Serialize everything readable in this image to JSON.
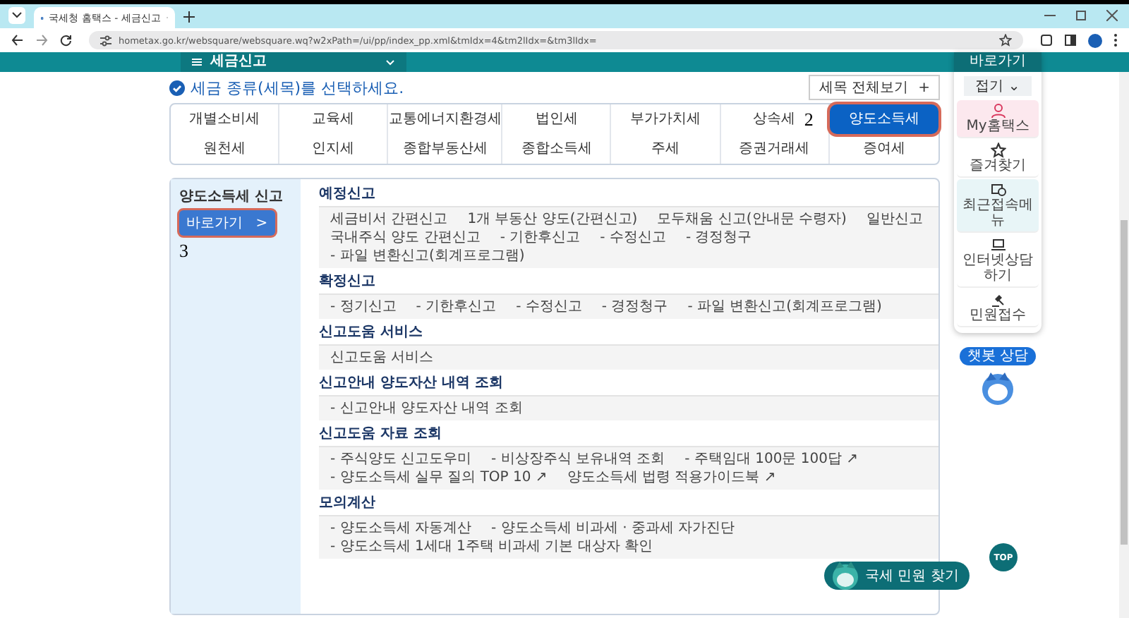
{
  "browser": {
    "tab_title": "국세청 홈택스 - 세금신고",
    "url": "hometax.go.kr/websquare/websquare.wq?w2xPath=/ui/pp/index_pp.xml&tmIdx=4&tm2lIdx=&tm3lIdx="
  },
  "nav": {
    "menu": "세금신고"
  },
  "heading": "세금 종류(세목)를 선택하세요.",
  "view_all": {
    "label": "세목 전체보기",
    "icon": "+"
  },
  "tax_types": [
    {
      "label": "개별소비세",
      "selected": false
    },
    {
      "label": "교육세",
      "selected": false
    },
    {
      "label": "교통에너지환경세",
      "selected": false
    },
    {
      "label": "법인세",
      "selected": false
    },
    {
      "label": "부가가치세",
      "selected": false
    },
    {
      "label": "상속세",
      "selected": false
    },
    {
      "label": "양도소득세",
      "selected": true
    },
    {
      "label": "원천세",
      "selected": false
    },
    {
      "label": "인지세",
      "selected": false
    },
    {
      "label": "종합부동산세",
      "selected": false
    },
    {
      "label": "종합소득세",
      "selected": false
    },
    {
      "label": "주세",
      "selected": false
    },
    {
      "label": "증권거래세",
      "selected": false
    },
    {
      "label": "증여세",
      "selected": false
    }
  ],
  "annotations": [
    "2",
    "3"
  ],
  "side": {
    "title": "양도소득세 신고",
    "button": "바로가기",
    "arrow": ">"
  },
  "sections": [
    {
      "title": "예정신고",
      "items": [
        "세금비서 간편신고",
        "1개 부동산 양도(간편신고)",
        "모두채움 신고(안내문 수령자)",
        "일반신고",
        "국내주식 양도 간편신고",
        "- 기한후신고",
        "- 수정신고",
        "- 경정청구",
        "- 파일 변환신고(회계프로그램)"
      ]
    },
    {
      "title": "확정신고",
      "items": [
        "- 정기신고",
        "- 기한후신고",
        "- 수정신고",
        "- 경정청구",
        "- 파일 변환신고(회계프로그램)"
      ]
    },
    {
      "title": "신고도움 서비스",
      "items": [
        "신고도움 서비스"
      ]
    },
    {
      "title": "신고안내 양도자산 내역 조회",
      "items": [
        "- 신고안내 양도자산 내역 조회"
      ]
    },
    {
      "title": "신고도움 자료 조회",
      "items": [
        "- 주식양도 신고도우미",
        "- 비상장주식 보유내역 조회",
        "- 주택임대 100문 100답 ↗",
        "- 양도소득세 실무 질의 TOP 10 ↗",
        "양도소득세 법령 적용가이드북 ↗"
      ]
    },
    {
      "title": "모의계산",
      "items": [
        "- 양도소득세 자동계산",
        "- 양도소득세 비과세 · 중과세 자가진단",
        "- 양도소득세 1세대 1주택 비과세 기본 대상자 확인"
      ]
    }
  ],
  "quick": {
    "title": "바로가기",
    "collapse": "접기 ⌄",
    "items": [
      {
        "label": "My홈택스",
        "kind": "person",
        "color": "#fce8ee"
      },
      {
        "label": "즐겨찾기",
        "kind": "star",
        "color": "#ffffff"
      },
      {
        "label": "최근접속메뉴",
        "kind": "recent",
        "color": "#e8f5f7"
      },
      {
        "label": "인터넷상담하기",
        "kind": "laptop",
        "color": "#ffffff"
      },
      {
        "label": "민원접수",
        "kind": "gavel",
        "color": "#ffffff"
      }
    ]
  },
  "chatbot": "챗봇 상담",
  "top": "TOP",
  "find": "국세 민원 찾기"
}
